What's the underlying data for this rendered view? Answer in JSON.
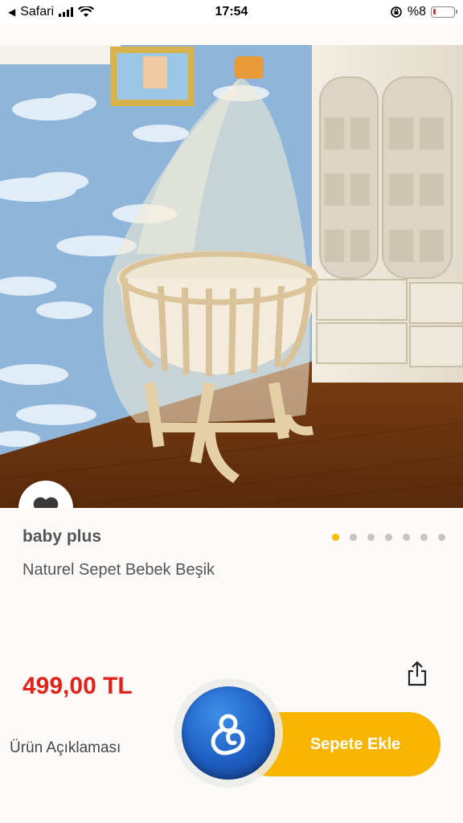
{
  "status_bar": {
    "back_app": "Safari",
    "time": "17:54",
    "battery": "%8"
  },
  "product": {
    "brand": "baby plus",
    "name": "Naturel Sepet Bebek Beşik",
    "price": "499,00 TL",
    "image_count": 7,
    "active_image_index": 0
  },
  "actions": {
    "description_link": "Ürün Açıklaması",
    "add_to_cart": "Sepete Ekle"
  },
  "colors": {
    "accent_yellow": "#f7b500",
    "price_red": "#e2231a",
    "assistant_blue": "#1e5fc4"
  },
  "icons": [
    "back-arrow-icon",
    "signal-icon",
    "wifi-icon",
    "lock-rotation-icon",
    "battery-icon",
    "heart-icon",
    "share-icon",
    "assistant-icon"
  ]
}
